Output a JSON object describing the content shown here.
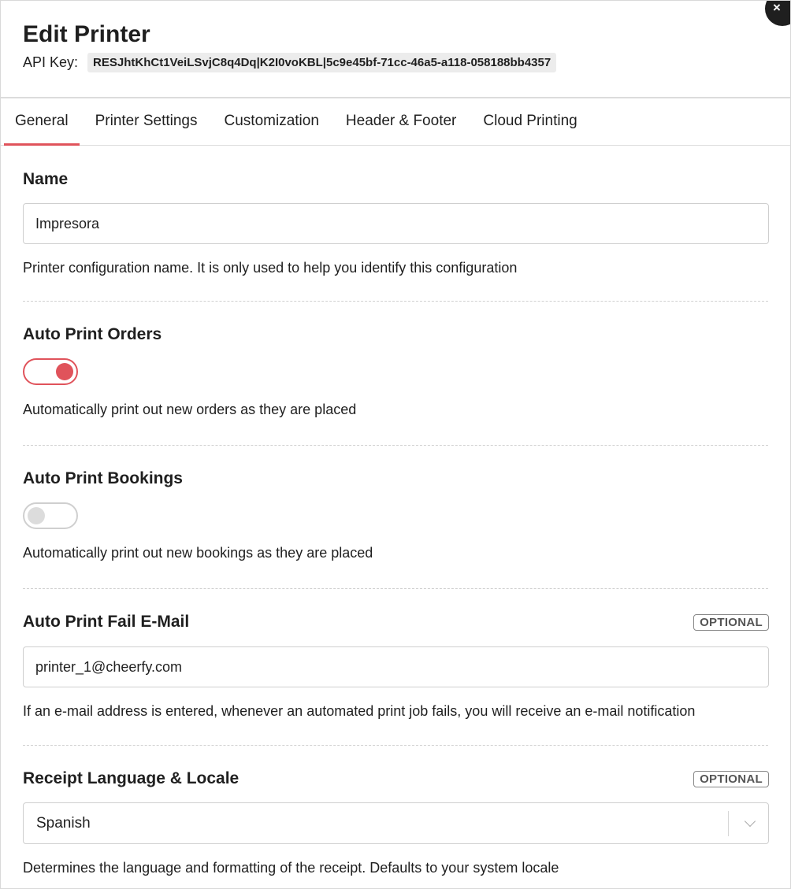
{
  "header": {
    "title": "Edit Printer",
    "api_key_label": "API Key:",
    "api_key_value": "RESJhtKhCt1VeiLSvjC8q4Dq|K2I0voKBL|5c9e45bf-71cc-46a5-a118-058188bb4357",
    "close_icon": "×"
  },
  "tabs": [
    {
      "label": "General",
      "active": true
    },
    {
      "label": "Printer Settings",
      "active": false
    },
    {
      "label": "Customization",
      "active": false
    },
    {
      "label": "Header & Footer",
      "active": false
    },
    {
      "label": "Cloud Printing",
      "active": false
    }
  ],
  "name_section": {
    "title": "Name",
    "value": "Impresora",
    "help": "Printer configuration name. It is only used to help you identify this configuration"
  },
  "auto_print_orders": {
    "title": "Auto Print Orders",
    "enabled": true,
    "help": "Automatically print out new orders as they are placed"
  },
  "auto_print_bookings": {
    "title": "Auto Print Bookings",
    "enabled": false,
    "help": "Automatically print out new bookings as they are placed"
  },
  "fail_email": {
    "title": "Auto Print Fail E-Mail",
    "badge": "OPTIONAL",
    "value": "printer_1@cheerfy.com",
    "help": "If an e-mail address is entered, whenever an automated print job fails, you will receive an e-mail notification"
  },
  "locale": {
    "title": "Receipt Language & Locale",
    "badge": "OPTIONAL",
    "selected": "Spanish",
    "help": "Determines the language and formatting of the receipt. Defaults to your system locale"
  },
  "colors": {
    "accent": "#e0535b"
  }
}
